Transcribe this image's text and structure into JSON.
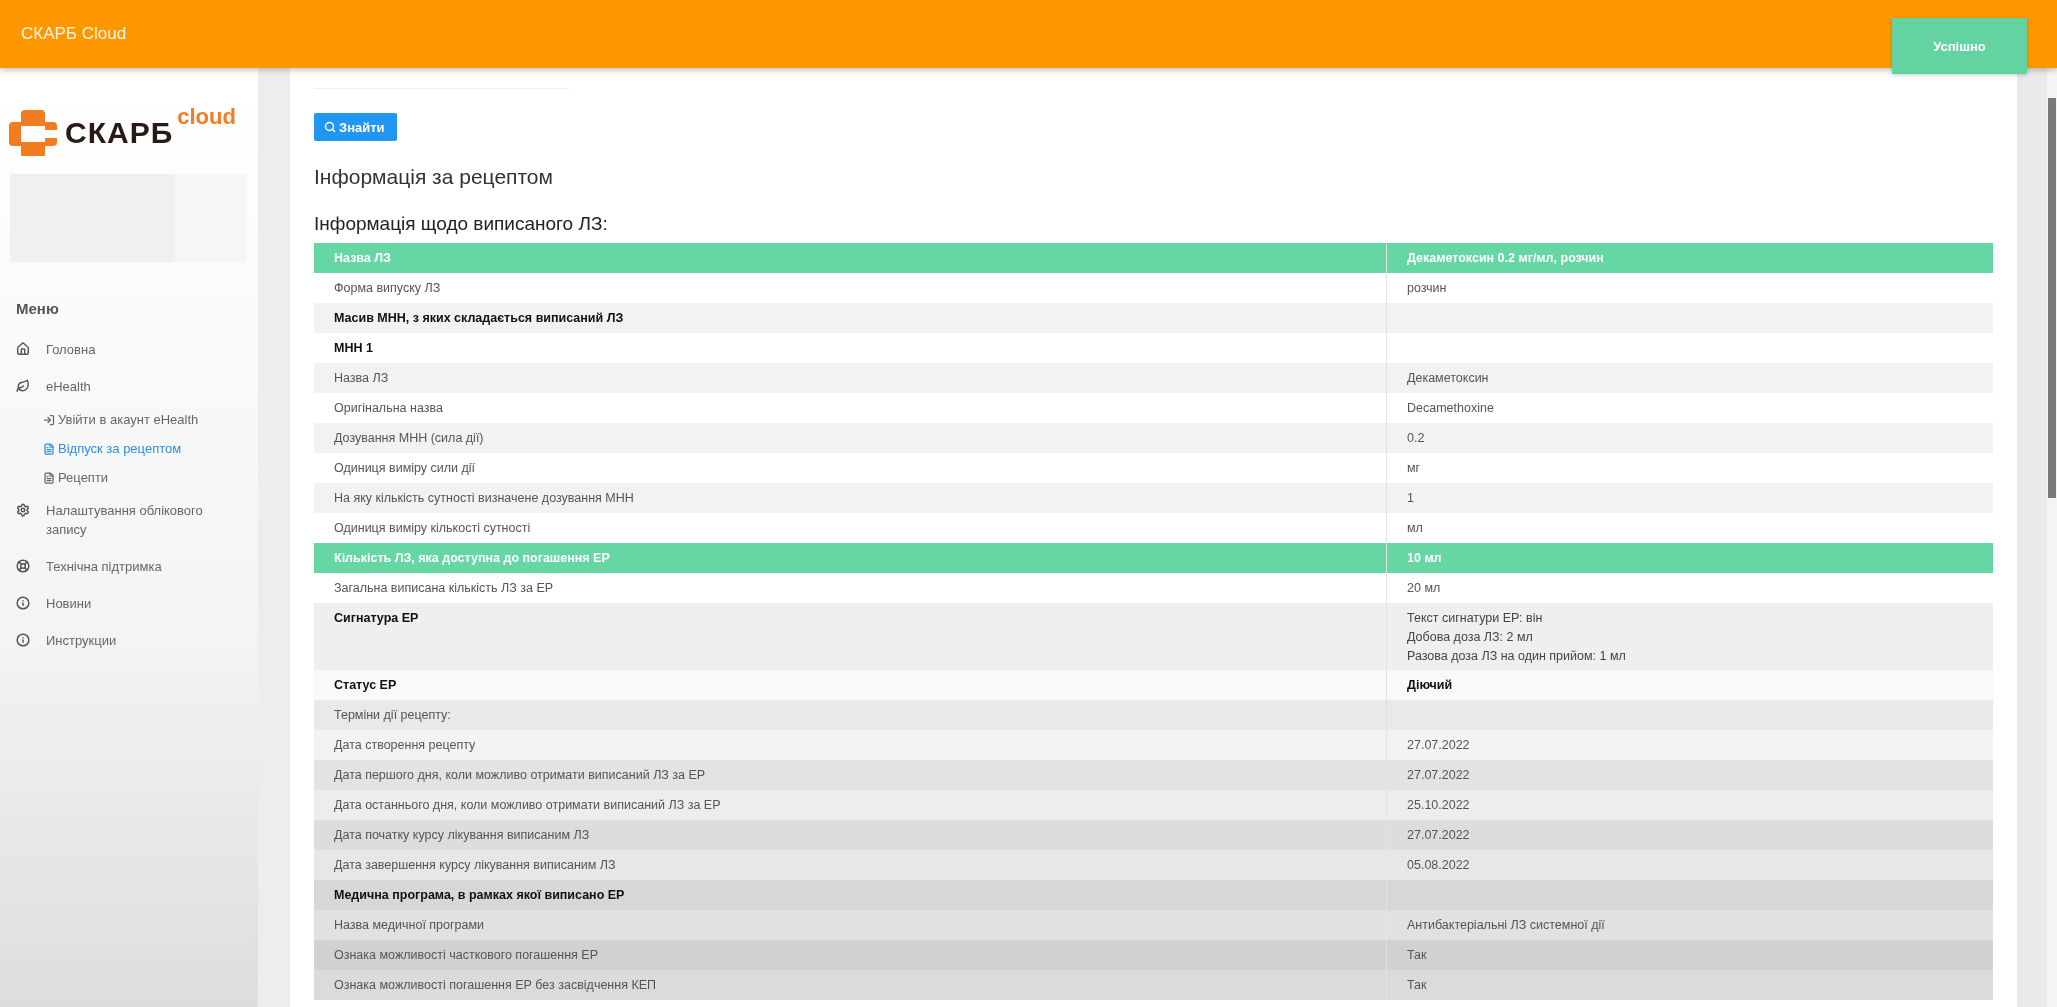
{
  "header": {
    "title": "СКАРБ Cloud"
  },
  "toast": {
    "text": "Успішно"
  },
  "logo": {
    "name": "СКАРБ",
    "suffix": "cloud"
  },
  "sidebar": {
    "menu_title": "Меню",
    "items": [
      {
        "label": "Головна",
        "selected": false
      },
      {
        "label": "eHealth",
        "selected": false,
        "children": [
          {
            "label": "Увійти в акаунт eHealth",
            "selected": false
          },
          {
            "label": "Відпуск за рецептом",
            "selected": true
          },
          {
            "label": "Рецепти",
            "selected": false
          }
        ]
      },
      {
        "label": "Налаштування облікового запису",
        "selected": false
      },
      {
        "label": "Технічна підтримка",
        "selected": false
      },
      {
        "label": "Новини",
        "selected": false
      },
      {
        "label": "Инструкции",
        "selected": false
      }
    ]
  },
  "search_button": {
    "label": "Знайти"
  },
  "title": "Інформація за рецептом",
  "subtitle": "Інформація щодо виписаного ЛЗ:",
  "table": {
    "rows": [
      {
        "kind": "highlight",
        "label": "Назва ЛЗ",
        "value": "Декаметоксин 0.2 мг/мл, розчин"
      },
      {
        "kind": "plain",
        "label": "Форма випуску ЛЗ",
        "value": "розчин"
      },
      {
        "kind": "section",
        "label": "Масив МНН, з яких складається виписаний ЛЗ"
      },
      {
        "kind": "section",
        "label": "МНН 1"
      },
      {
        "kind": "plain",
        "label": "Назва ЛЗ",
        "value": "Декаметоксин"
      },
      {
        "kind": "plain",
        "label": "Оригінальна назва",
        "value": "Decamethoxine"
      },
      {
        "kind": "plain",
        "label": "Дозування МНН (сила дії)",
        "value": "0.2"
      },
      {
        "kind": "plain",
        "label": "Одиниця виміру сили дії",
        "value": "мг"
      },
      {
        "kind": "plain",
        "label": "На яку кількість сутності визначене дозування МНН",
        "value": "1"
      },
      {
        "kind": "plain",
        "label": "Одиниця виміру кількості сутності",
        "value": "мл"
      },
      {
        "kind": "highlight",
        "label": "Кількість ЛЗ, яка доступна до погашення ЕР",
        "value": "10 мл"
      },
      {
        "kind": "plain",
        "label": "Загальна виписана кількість ЛЗ за ЕР",
        "value": "20 мл"
      },
      {
        "kind": "section",
        "label": "Сигнатура ЕР",
        "lines": [
          "Текст сигнатури ЕР: він",
          "Добова доза ЛЗ: 2 мл",
          "Разова доза ЛЗ на один прийом: 1 мл"
        ]
      },
      {
        "kind": "section",
        "label": "Статус ЕР",
        "value": "Діючий",
        "value_bold": true
      },
      {
        "kind": "plain",
        "label": "Терміни дії рецепту:"
      },
      {
        "kind": "plain",
        "label": "Дата створення рецепту",
        "value": "27.07.2022"
      },
      {
        "kind": "plain",
        "label": "Дата першого дня, коли можливо отримати виписаний ЛЗ за ЕР",
        "value": "27.07.2022"
      },
      {
        "kind": "plain",
        "label": "Дата останнього дня, коли можливо отримати виписаний ЛЗ за ЕР",
        "value": "25.10.2022"
      },
      {
        "kind": "plain",
        "label": "Дата початку курсу лікування виписаним ЛЗ",
        "value": "27.07.2022"
      },
      {
        "kind": "plain",
        "label": "Дата завершення курсу лікування виписаним ЛЗ",
        "value": "05.08.2022"
      },
      {
        "kind": "section",
        "label": "Медична програма, в рамках якої виписано ЕР"
      },
      {
        "kind": "plain",
        "label": "Назва медичної програми",
        "value": "Антибактеріальні ЛЗ системної дії"
      },
      {
        "kind": "plain",
        "label": "Ознака можливості часткового погашення ЕР",
        "value": "Так"
      },
      {
        "kind": "plain",
        "label": "Ознака можливості погашення ЕР без засвідчення КЕП",
        "value": "Так"
      }
    ]
  }
}
